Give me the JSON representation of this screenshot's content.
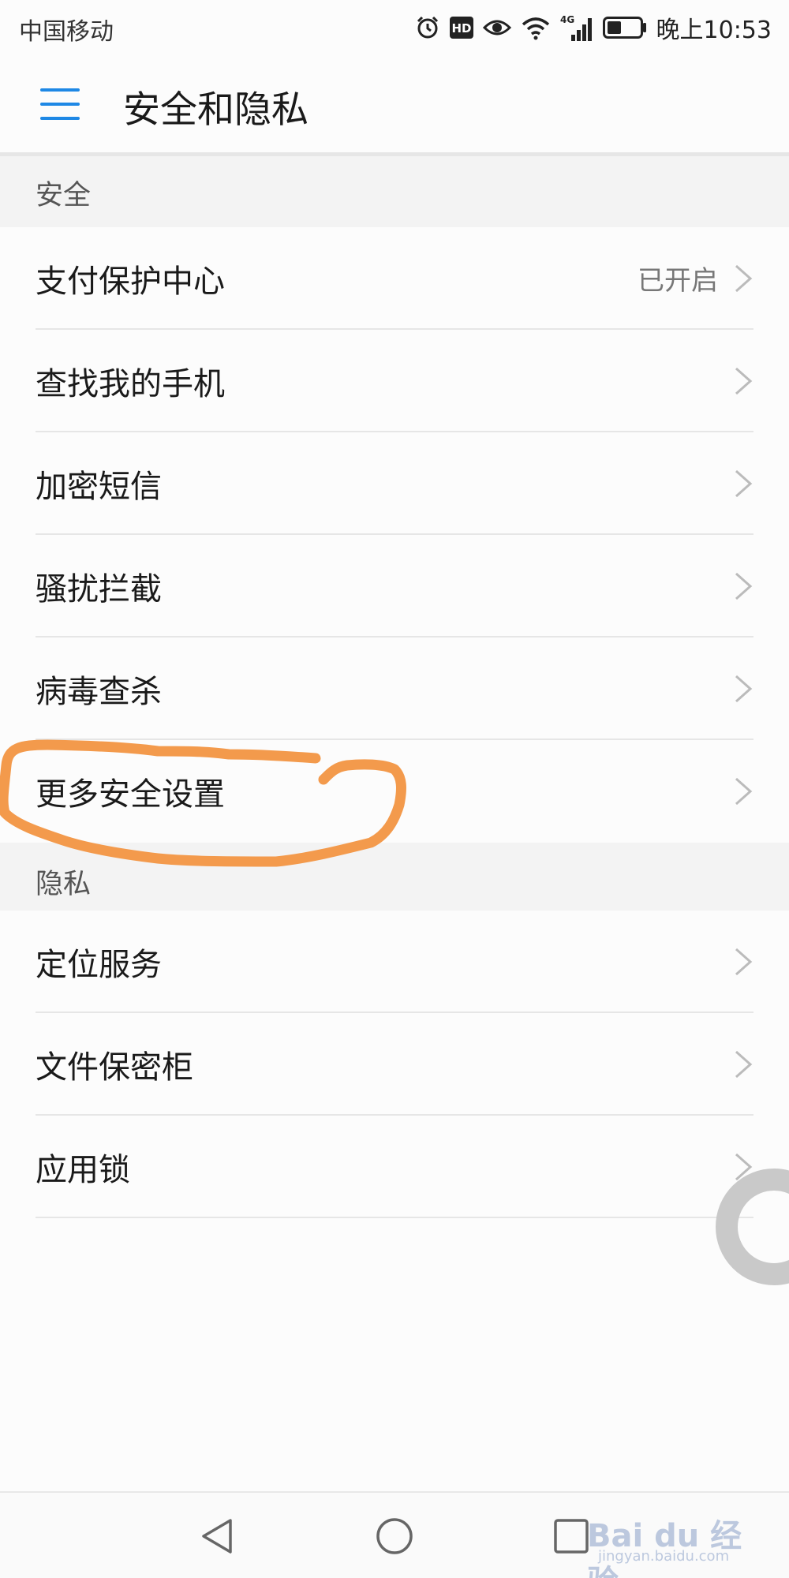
{
  "status_bar": {
    "carrier": "中国移动",
    "network": "4G",
    "hd_badge": "HD",
    "time": "晚上10:53",
    "icons": [
      "alarm-icon",
      "hd-icon",
      "eye-icon",
      "wifi-icon",
      "signal-icon",
      "battery-icon"
    ]
  },
  "app_bar": {
    "title": "安全和隐私",
    "menu_icon": "menu-icon"
  },
  "sections": {
    "security": {
      "header": "安全",
      "items": [
        {
          "label": "支付保护中心",
          "value": "已开启"
        },
        {
          "label": "查找我的手机",
          "value": ""
        },
        {
          "label": "加密短信",
          "value": ""
        },
        {
          "label": "骚扰拦截",
          "value": ""
        },
        {
          "label": "病毒查杀",
          "value": ""
        },
        {
          "label": "更多安全设置",
          "value": ""
        }
      ]
    },
    "privacy": {
      "header": "隐私",
      "items": [
        {
          "label": "定位服务",
          "value": ""
        },
        {
          "label": "文件保密柜",
          "value": ""
        },
        {
          "label": "应用锁",
          "value": ""
        }
      ]
    }
  },
  "colors": {
    "accent": "#1e88e5",
    "annotation": "#f39a4c",
    "section_background": "#f3f3f3"
  },
  "nav_bar": {
    "icons": [
      "back-icon",
      "home-icon",
      "recents-icon"
    ]
  },
  "watermark": {
    "text": "Bai du 经验",
    "sub": "jingyan.baidu.com"
  }
}
